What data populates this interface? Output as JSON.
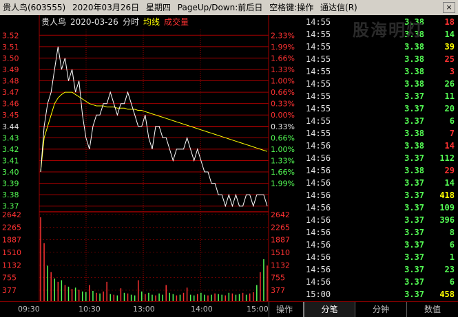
{
  "titlebar": {
    "stock": "贵人鸟(603555)",
    "date": "2020年03月26日",
    "weekday": "星期四",
    "nav_hint": "PageUp/Down:前后日",
    "space_hint": "空格键:操作",
    "app": "通达信(R)",
    "close_symbol": "×"
  },
  "watermark": "股海明灯",
  "chart_info": {
    "name": "贵人鸟",
    "date": "2020-03-26",
    "mode": "分时",
    "avg_label": "均线",
    "vol_label": "成交量"
  },
  "colors": {
    "up": "#ff3232",
    "down": "#54fc54",
    "flat": "#e6e6e6",
    "avg": "#ffff00",
    "vol_num": "#ffff00",
    "grid": "#a00000"
  },
  "chart_data": {
    "type": "line",
    "price_levels": [
      "3.52",
      "3.51",
      "3.50",
      "3.49",
      "3.48",
      "3.47",
      "3.46",
      "3.45",
      "3.44",
      "3.43",
      "3.42",
      "3.41",
      "3.40",
      "3.39",
      "3.38",
      "3.37"
    ],
    "pct_levels": [
      "2.33%",
      "1.99%",
      "1.66%",
      "1.33%",
      "1.00%",
      "0.66%",
      "0.33%",
      "0.00%",
      "0.33%",
      "0.66%",
      "1.00%",
      "1.33%",
      "1.66%",
      "1.99%"
    ],
    "prev_close": 3.44,
    "ylim": [
      3.365,
      3.525
    ],
    "vol_levels": [
      "2642",
      "2265",
      "1887",
      "1510",
      "1132",
      "755",
      "377"
    ],
    "vol_max": 2642,
    "time_labels": [
      "09:30",
      "10:30",
      "13:00",
      "14:00",
      "15:00"
    ],
    "price": [
      3.4,
      3.44,
      3.46,
      3.47,
      3.49,
      3.51,
      3.49,
      3.5,
      3.48,
      3.49,
      3.47,
      3.48,
      3.45,
      3.43,
      3.42,
      3.44,
      3.45,
      3.45,
      3.46,
      3.46,
      3.47,
      3.46,
      3.45,
      3.46,
      3.46,
      3.47,
      3.46,
      3.45,
      3.44,
      3.44,
      3.45,
      3.43,
      3.42,
      3.44,
      3.44,
      3.43,
      3.43,
      3.42,
      3.41,
      3.42,
      3.42,
      3.42,
      3.43,
      3.42,
      3.41,
      3.42,
      3.41,
      3.4,
      3.4,
      3.39,
      3.39,
      3.38,
      3.38,
      3.37,
      3.38,
      3.37,
      3.38,
      3.37,
      3.37,
      3.38,
      3.38,
      3.37,
      3.38,
      3.38,
      3.38,
      3.37
    ],
    "avg": [
      3.4,
      3.43,
      3.44,
      3.45,
      3.46,
      3.465,
      3.468,
      3.47,
      3.47,
      3.47,
      3.468,
      3.466,
      3.464,
      3.462,
      3.46,
      3.459,
      3.458,
      3.458,
      3.458,
      3.457,
      3.457,
      3.457,
      3.456,
      3.456,
      3.456,
      3.455,
      3.455,
      3.455,
      3.454,
      3.454,
      3.453,
      3.452,
      3.451,
      3.45,
      3.449,
      3.448,
      3.447,
      3.446,
      3.445,
      3.444,
      3.443,
      3.442,
      3.441,
      3.44,
      3.439,
      3.438,
      3.437,
      3.436,
      3.435,
      3.434,
      3.433,
      3.432,
      3.431,
      3.43,
      3.429,
      3.428,
      3.427,
      3.426,
      3.425,
      3.424,
      3.423,
      3.422,
      3.421,
      3.42,
      3.419,
      3.418
    ],
    "volume": [
      2600,
      1800,
      1100,
      900,
      700,
      600,
      650,
      500,
      450,
      380,
      420,
      350,
      300,
      280,
      500,
      320,
      260,
      240,
      300,
      600,
      220,
      200,
      180,
      400,
      260,
      240,
      200,
      180,
      650,
      300,
      220,
      260,
      200,
      180,
      240,
      200,
      500,
      260,
      220,
      180,
      200,
      260,
      420,
      200,
      180,
      220,
      260,
      200,
      180,
      200,
      240,
      220,
      200,
      180,
      260,
      240,
      200,
      220,
      260,
      200,
      240,
      280,
      500,
      900,
      1300,
      1100
    ],
    "volume_up": [
      1,
      1,
      0,
      1,
      0,
      1,
      0,
      1,
      0,
      1,
      0,
      1,
      0,
      0,
      1,
      0,
      1,
      0,
      1,
      1,
      0,
      1,
      0,
      1,
      0,
      1,
      0,
      0,
      1,
      0,
      1,
      0,
      0,
      1,
      0,
      0,
      1,
      0,
      0,
      1,
      0,
      1,
      1,
      0,
      0,
      1,
      0,
      0,
      1,
      0,
      1,
      0,
      0,
      1,
      0,
      1,
      0,
      0,
      1,
      0,
      1,
      1,
      0,
      1,
      0,
      1
    ]
  },
  "ticks": [
    {
      "time": "14:55",
      "price": "3.38",
      "vol": "18",
      "color": "up"
    },
    {
      "time": "14:55",
      "price": "3.38",
      "vol": "14",
      "color": "down"
    },
    {
      "time": "14:55",
      "price": "3.38",
      "vol": "39",
      "color": "vol"
    },
    {
      "time": "14:55",
      "price": "3.38",
      "vol": "25",
      "color": "up"
    },
    {
      "time": "14:55",
      "price": "3.38",
      "vol": "3",
      "color": "up"
    },
    {
      "time": "14:55",
      "price": "3.38",
      "vol": "26",
      "color": "down"
    },
    {
      "time": "14:55",
      "price": "3.37",
      "vol": "11",
      "color": "down"
    },
    {
      "time": "14:55",
      "price": "3.37",
      "vol": "20",
      "color": "down"
    },
    {
      "time": "14:55",
      "price": "3.37",
      "vol": "6",
      "color": "down"
    },
    {
      "time": "14:55",
      "price": "3.38",
      "vol": "7",
      "color": "up"
    },
    {
      "time": "14:56",
      "price": "3.38",
      "vol": "14",
      "color": "up"
    },
    {
      "time": "14:56",
      "price": "3.37",
      "vol": "112",
      "color": "down"
    },
    {
      "time": "14:56",
      "price": "3.38",
      "vol": "29",
      "color": "up"
    },
    {
      "time": "14:56",
      "price": "3.37",
      "vol": "14",
      "color": "down"
    },
    {
      "time": "14:56",
      "price": "3.37",
      "vol": "418",
      "color": "vol"
    },
    {
      "time": "14:56",
      "price": "3.37",
      "vol": "109",
      "color": "down"
    },
    {
      "time": "14:56",
      "price": "3.37",
      "vol": "396",
      "color": "down"
    },
    {
      "time": "14:56",
      "price": "3.37",
      "vol": "8",
      "color": "down"
    },
    {
      "time": "14:56",
      "price": "3.37",
      "vol": "6",
      "color": "down"
    },
    {
      "time": "14:56",
      "price": "3.37",
      "vol": "1",
      "color": "down"
    },
    {
      "time": "14:56",
      "price": "3.37",
      "vol": "23",
      "color": "down"
    },
    {
      "time": "14:56",
      "price": "3.37",
      "vol": "6",
      "color": "down"
    },
    {
      "time": "15:00",
      "price": "3.37",
      "vol": "458",
      "color": "vol"
    }
  ],
  "bottom_tabs": [
    "操作",
    "分笔",
    "分钟",
    "数值"
  ],
  "active_tab": "分笔"
}
